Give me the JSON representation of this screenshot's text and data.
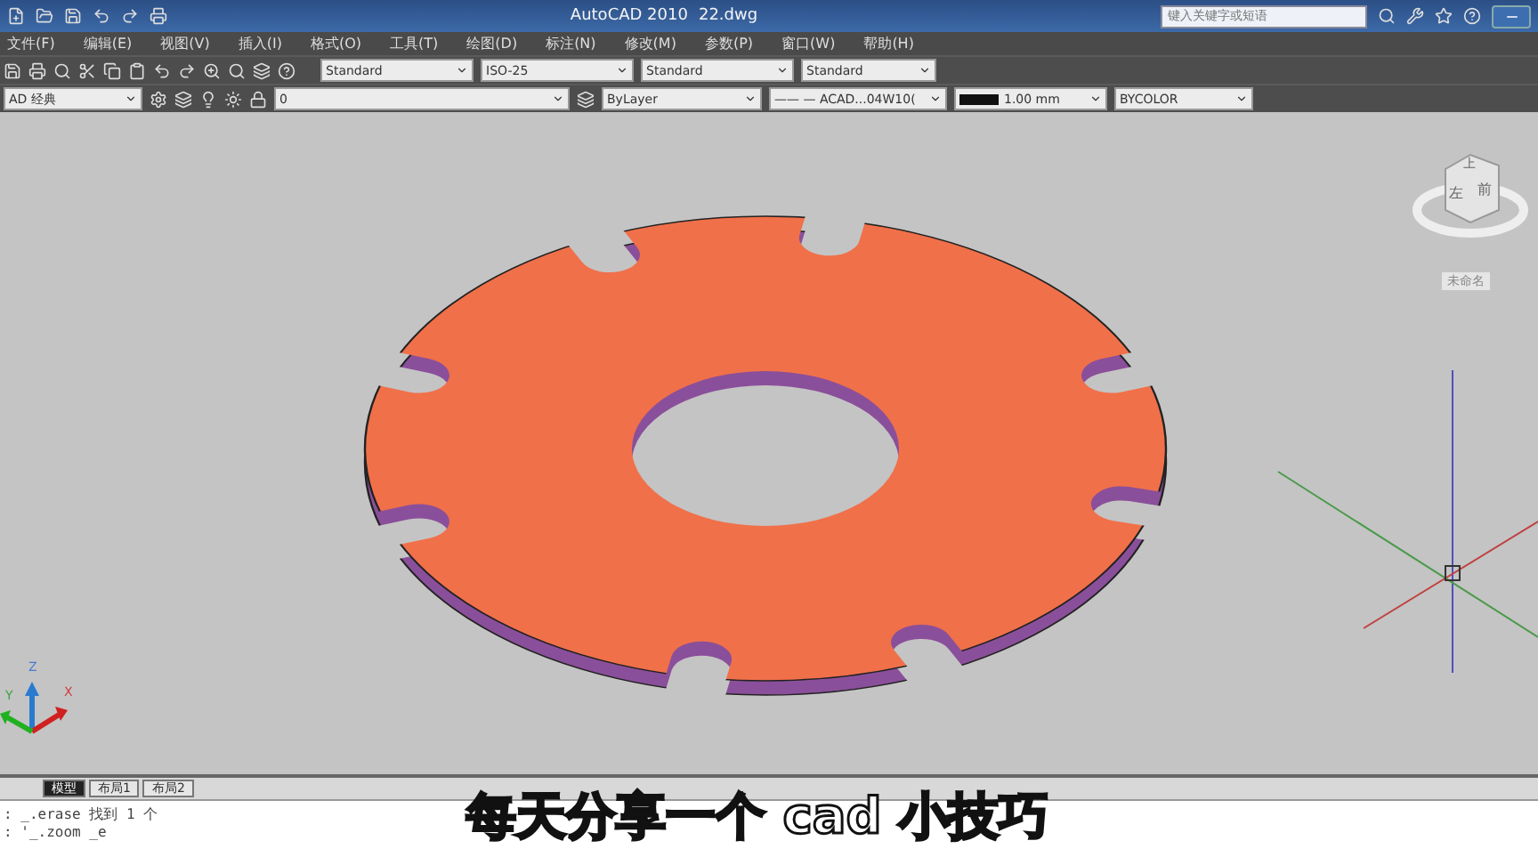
{
  "title_bar": {
    "app": "AutoCAD 2010",
    "file": "22.dwg",
    "search": {
      "placeholder": "键入关键字或短语"
    }
  },
  "menu": [
    "文件(F)",
    "编辑(E)",
    "视图(V)",
    "插入(I)",
    "格式(O)",
    "工具(T)",
    "绘图(D)",
    "标注(N)",
    "修改(M)",
    "参数(P)",
    "窗口(W)",
    "帮助(H)"
  ],
  "styles_toolbar": {
    "text_style": "Standard",
    "dim_style": "ISO-25",
    "table_style": "Standard",
    "multileader_style": "Standard"
  },
  "properties_bar": {
    "workspace": "AD 经典",
    "layer": "0",
    "color_setting": "ByLayer",
    "linetype": "—— — ACAD...04W10(",
    "lineweight": "1.00 mm",
    "plot_style": "BYCOLOR"
  },
  "viewcube": {
    "top": "上",
    "left": "左",
    "front": "前",
    "ucs_menu": "未命名"
  },
  "ucs": {
    "x": "X",
    "y": "Y",
    "z": "Z"
  },
  "layout_tabs": [
    {
      "label": "模型",
      "selected": true
    },
    {
      "label": "布局1",
      "selected": false
    },
    {
      "label": "布局2",
      "selected": false
    }
  ],
  "command_lines": [
    ": _.erase 找到 1 个",
    ": '_.zoom _e"
  ],
  "subtitle": "每天分享一个 cad 小技巧"
}
